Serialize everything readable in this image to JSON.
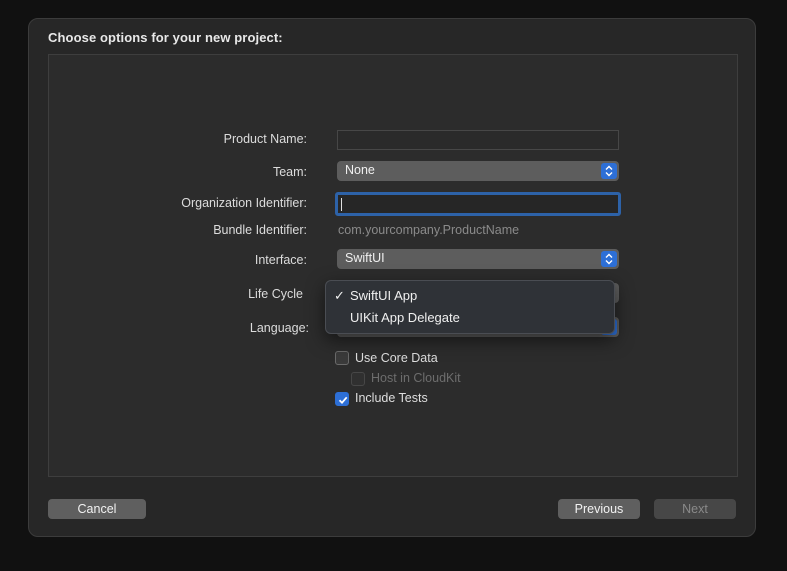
{
  "dialog": {
    "title": "Choose options for your new project:"
  },
  "form": {
    "product_name": {
      "label": "Product Name:",
      "value": ""
    },
    "team": {
      "label": "Team:",
      "value": "None"
    },
    "org_identifier": {
      "label": "Organization Identifier:",
      "value": ""
    },
    "bundle_identifier": {
      "label": "Bundle Identifier:",
      "value": "com.yourcompany.ProductName"
    },
    "interface": {
      "label": "Interface:",
      "value": "SwiftUI"
    },
    "life_cycle": {
      "label": "Life Cycle"
    },
    "language": {
      "label": "Language:"
    },
    "use_core_data": {
      "label": "Use Core Data",
      "checked": false
    },
    "host_in_cloudkit": {
      "label": "Host in CloudKit",
      "checked": false,
      "enabled": false
    },
    "include_tests": {
      "label": "Include Tests",
      "checked": true
    }
  },
  "life_cycle_menu": {
    "items": [
      {
        "label": "SwiftUI App",
        "selected": true,
        "mark": "✓"
      },
      {
        "label": "UIKit App Delegate",
        "selected": false,
        "mark": ""
      }
    ]
  },
  "buttons": {
    "cancel": "Cancel",
    "previous": "Previous",
    "next": "Next"
  },
  "colors": {
    "accent": "#2d6fd6",
    "sheet_background": "#272727",
    "panel_background": "#2c2c2c"
  }
}
